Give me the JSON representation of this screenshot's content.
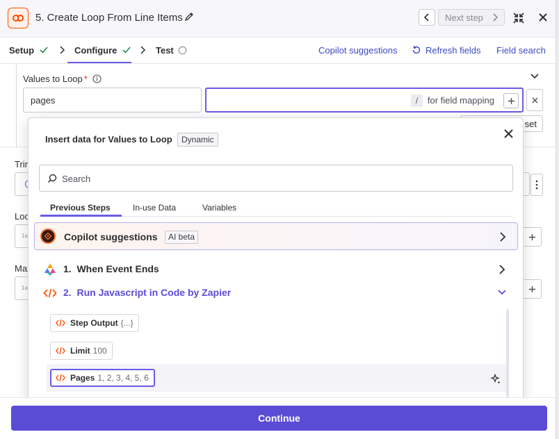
{
  "header": {
    "step_title": "5. Create Loop From Line Items",
    "next_label": "Next step"
  },
  "tabs": [
    {
      "label": "Setup",
      "status": "complete"
    },
    {
      "label": "Configure",
      "status": "complete",
      "active": true
    },
    {
      "label": "Test",
      "status": "pending"
    }
  ],
  "actions": {
    "copilot": "Copilot suggestions",
    "refresh": "Refresh fields",
    "field_search": "Field search"
  },
  "field": {
    "label": "Values to Loop",
    "required_mark": "*",
    "key_value": "pages",
    "slash_key": "/",
    "mapping_hint": "for field mapping"
  },
  "background": {
    "set_button_fragment": "set",
    "labels": [
      "Trin",
      "Loo",
      "Max"
    ],
    "mini_placeholder": "1a"
  },
  "popover": {
    "title": "Insert data for Values to Loop",
    "badge": "Dynamic",
    "search_placeholder": "Search",
    "tabs": [
      "Previous Steps",
      "In-use Data",
      "Variables"
    ],
    "copilot_label": "Copilot suggestions",
    "copilot_badge": "AI beta",
    "steps": [
      {
        "number": "1.",
        "name": "When Event Ends",
        "expanded": false
      },
      {
        "number": "2.",
        "name": "Run Javascript in Code by Zapier",
        "expanded": true
      }
    ],
    "fields": [
      {
        "name": "Step Output",
        "value": "{...}",
        "selected": false
      },
      {
        "name": "Limit",
        "value": "100",
        "selected": false
      },
      {
        "name": "Pages",
        "value": "1, 2, 3, 4, 5, 6",
        "selected": true
      }
    ]
  },
  "footer": {
    "continue_label": "Continue"
  },
  "colors": {
    "accent": "#695be8",
    "primary_button": "#5b4cd6",
    "link": "#3d4ac2",
    "brand_orange": "#ff4f00",
    "check_green": "#1f8a4c",
    "required_red": "#e2352e"
  }
}
